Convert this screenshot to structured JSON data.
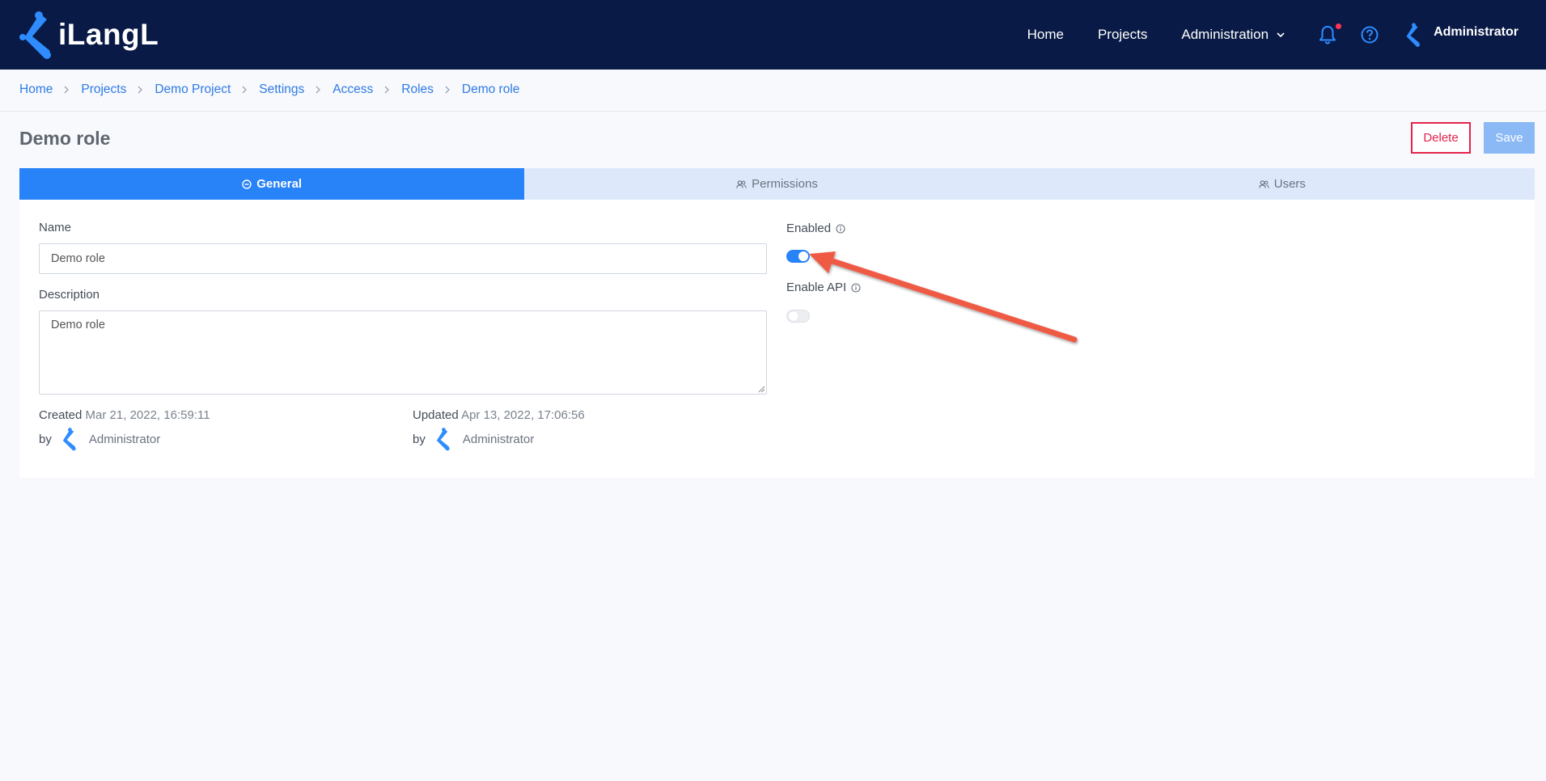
{
  "app": {
    "logo_text": "iLangL"
  },
  "nav": {
    "home": "Home",
    "projects": "Projects",
    "administration": "Administration",
    "user_name": "Administrator"
  },
  "breadcrumb": [
    "Home",
    "Projects",
    "Demo Project",
    "Settings",
    "Access",
    "Roles",
    "Demo role"
  ],
  "page": {
    "title": "Demo role",
    "delete_label": "Delete",
    "save_label": "Save"
  },
  "tabs": [
    {
      "label": "General",
      "icon": "minus-circle-icon",
      "active": true
    },
    {
      "label": "Permissions",
      "icon": "users-icon",
      "active": false
    },
    {
      "label": "Users",
      "icon": "users-icon",
      "active": false
    }
  ],
  "form": {
    "name_label": "Name",
    "name_value": "Demo role",
    "description_label": "Description",
    "description_value": "Demo role",
    "enabled_label": "Enabled",
    "enabled": true,
    "enable_api_label": "Enable API",
    "enable_api": false
  },
  "meta": {
    "created_label": "Created",
    "created_value": "Mar 21, 2022, 16:59:11",
    "created_by_prefix": "by",
    "created_by": "Administrator",
    "updated_label": "Updated",
    "updated_value": "Apr 13, 2022, 17:06:56",
    "updated_by_prefix": "by",
    "updated_by": "Administrator"
  },
  "colors": {
    "topbar": "#081a45",
    "accent": "#2882f8",
    "danger": "#e4234b",
    "annotation_arrow": "#ef5a45"
  }
}
